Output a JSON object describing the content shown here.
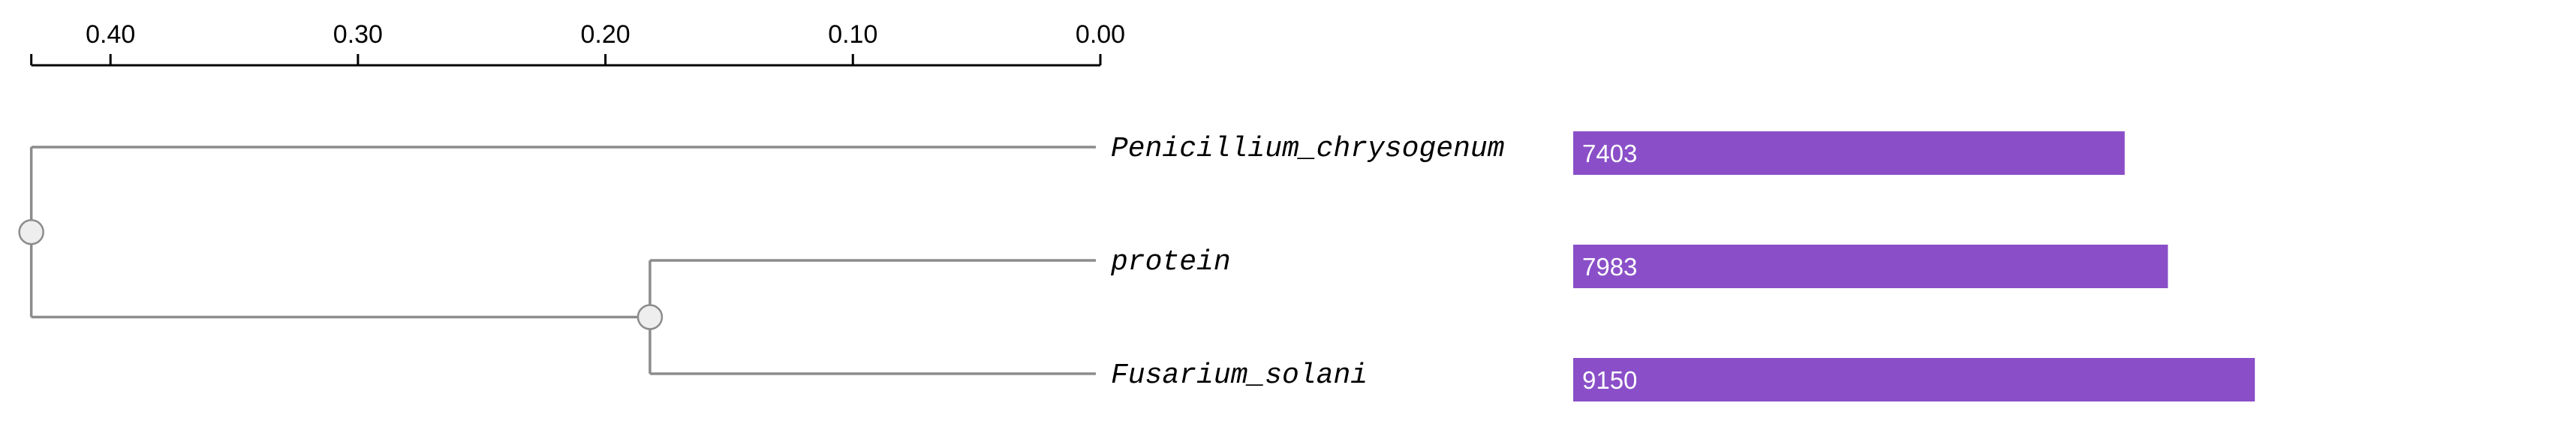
{
  "scale_axis": {
    "ticks": [
      {
        "value": 0.4,
        "label": "0.40"
      },
      {
        "value": 0.3,
        "label": "0.30"
      },
      {
        "value": 0.2,
        "label": "0.20"
      },
      {
        "value": 0.1,
        "label": "0.10"
      },
      {
        "value": 0.0,
        "label": "0.00"
      }
    ],
    "domain_max": 0.432,
    "minor_tick_values": [
      0.432
    ]
  },
  "tree": {
    "root": {
      "height": 0.432
    },
    "internal": {
      "height": 0.182
    },
    "leaves": [
      {
        "name": "Penicillium_chrysogenum",
        "height": 0.0
      },
      {
        "name": "protein",
        "height": 0.0
      },
      {
        "name": "Fusarium_solani",
        "height": 0.0
      }
    ]
  },
  "bars": {
    "color": "#8a4fc8",
    "max_value": 12360,
    "items": [
      {
        "leaf": "Penicillium_chrysogenum",
        "value": 7403,
        "label": "7403"
      },
      {
        "leaf": "protein",
        "value": 7983,
        "label": "7983"
      },
      {
        "leaf": "Fusarium_solani",
        "value": 9150,
        "label": "9150"
      }
    ]
  },
  "colors": {
    "branch": "#8c8c8c",
    "node_fill": "#eeeeee",
    "axis": "#000000",
    "bar": "#8a4fc8"
  }
}
